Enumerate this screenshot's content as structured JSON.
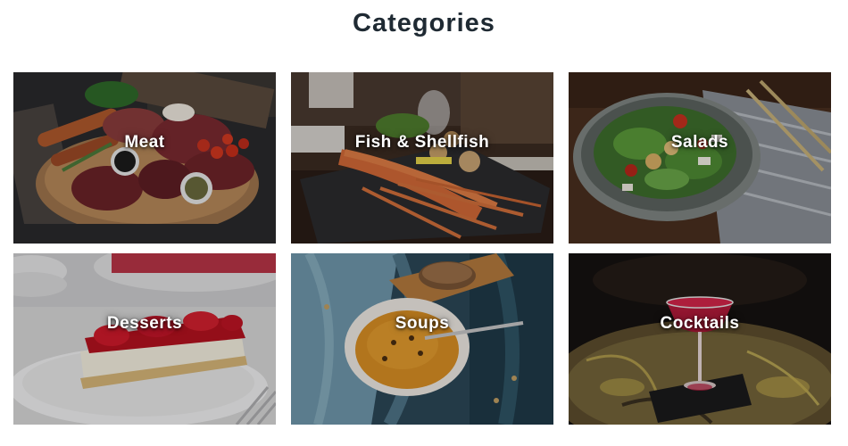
{
  "page": {
    "title": "Categories"
  },
  "categories": [
    {
      "label": "Meat",
      "image": "meat-platter-photo"
    },
    {
      "label": "Fish & Shellfish",
      "image": "lobster-plate-photo"
    },
    {
      "label": "Salads",
      "image": "salad-bowl-photo"
    },
    {
      "label": "Desserts",
      "image": "cheesecake-photo"
    },
    {
      "label": "Soups",
      "image": "soup-bowl-photo"
    },
    {
      "label": "Cocktails",
      "image": "cocktail-glass-photo"
    }
  ],
  "colors": {
    "title": "#1f2a33",
    "label": "#ffffff"
  }
}
